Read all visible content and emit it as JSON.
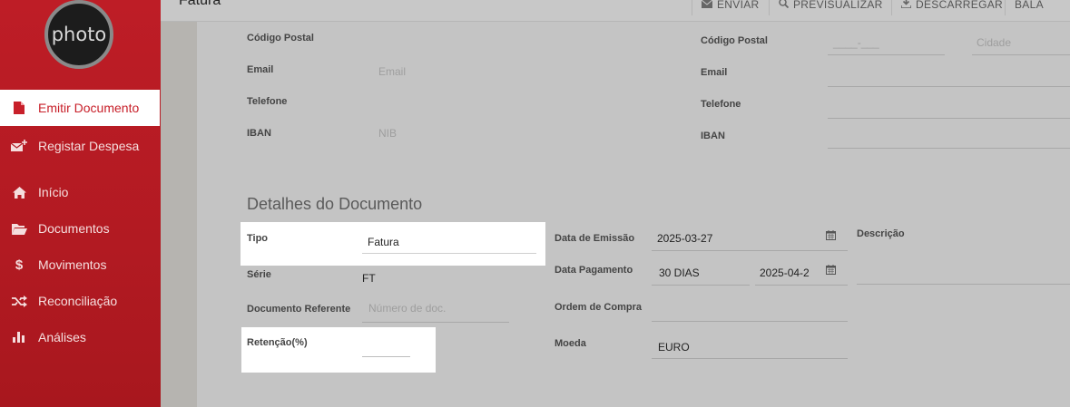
{
  "sidebar": {
    "avatar_text": "photo",
    "items": [
      {
        "label": "Emitir Documento",
        "icon": "file-icon"
      },
      {
        "label": "Registar Despesa",
        "icon": "mail-plus-icon"
      },
      {
        "label": "Início",
        "icon": "home-icon"
      },
      {
        "label": "Documentos",
        "icon": "folder-icon"
      },
      {
        "label": "Movimentos",
        "icon": "dollar-icon"
      },
      {
        "label": "Reconciliação",
        "icon": "shuffle-icon"
      },
      {
        "label": "Análises",
        "icon": "bar-chart-icon"
      }
    ]
  },
  "topbar": {
    "title": "Fatura",
    "actions": [
      "ENVIAR",
      "PREVISUALIZAR",
      "DESCARREGAR",
      "BALA"
    ]
  },
  "client": {
    "postal_code_label": "Código Postal",
    "email_label": "Email",
    "email_placeholder": "Email",
    "phone_label": "Telefone",
    "iban_label": "IBAN",
    "iban_placeholder": "NIB"
  },
  "company": {
    "postal_code_label": "Código Postal",
    "postal_code_placeholder": "____-___",
    "city_placeholder": "Cidade",
    "email_label": "Email",
    "phone_label": "Telefone",
    "iban_label": "IBAN"
  },
  "details": {
    "title": "Detalhes do Documento",
    "tipo_label": "Tipo",
    "tipo_value": "Fatura",
    "serie_label": "Série",
    "serie_value": "FT",
    "doc_ref_label": "Documento Referente",
    "doc_ref_placeholder": "Número de doc.",
    "retencao_label": "Retenção(%)",
    "emission_label": "Data de Emissão",
    "emission_value": "2025-03-27",
    "payment_label": "Data Pagamento",
    "payment_terms": "30 DIAS",
    "payment_value": "2025-04-2",
    "order_label": "Ordem de Compra",
    "currency_label": "Moeda",
    "currency_value": "EURO",
    "description_label": "Descrição"
  },
  "colors": {
    "sidebar": "#be1d26",
    "active_text": "#c8202a",
    "overlay": "#c4c4c4"
  }
}
